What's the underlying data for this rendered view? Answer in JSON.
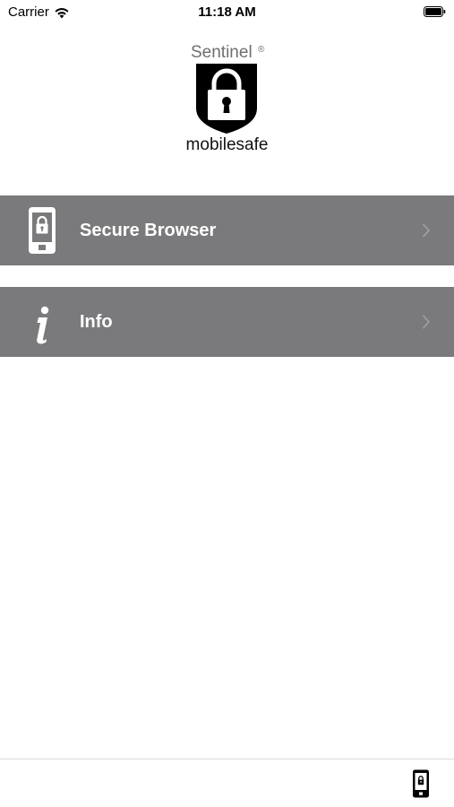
{
  "status_bar": {
    "carrier": "Carrier",
    "time": "11:18 AM"
  },
  "logo": {
    "brand": "Sentinel",
    "registered_mark": "®",
    "product": "mobilesafe"
  },
  "menu": {
    "items": [
      {
        "label": "Secure Browser",
        "icon": "locked-phone-icon"
      },
      {
        "label": "Info",
        "icon": "info-icon"
      }
    ]
  },
  "toolbar": {
    "icon": "locked-phone-icon"
  },
  "colors": {
    "row_background": "#7a7a7c",
    "row_text": "#ffffff",
    "background": "#ffffff"
  }
}
